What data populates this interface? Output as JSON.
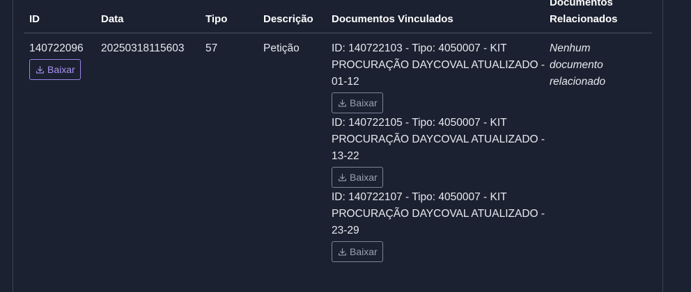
{
  "table": {
    "headers": {
      "id": "ID",
      "data": "Data",
      "tipo": "Tipo",
      "descricao": "Descrição",
      "vinculados": "Documentos Vinculados",
      "relacionados_line1": "Documentos",
      "relacionados_line2": "Relacionados"
    },
    "row": {
      "id": "140722096",
      "data": "20250318115603",
      "tipo": "57",
      "descricao": "Petição",
      "download_label": "Baixar",
      "relacionados": [
        "Nenhum",
        "documento",
        "relacionado"
      ],
      "vinculados": [
        {
          "lines": [
            "ID: 140722103 - Tipo: 4050007 - KIT",
            "PROCURAÇÃO DAYCOVAL ATUALIZADO -",
            "01-12"
          ],
          "download_label": "Baixar"
        },
        {
          "lines": [
            "ID: 140722105 - Tipo: 4050007 - KIT",
            "PROCURAÇÃO DAYCOVAL ATUALIZADO -",
            "13-22"
          ],
          "download_label": "Baixar"
        },
        {
          "lines": [
            "ID: 140722107 - Tipo: 4050007 - KIT",
            "PROCURAÇÃO DAYCOVAL ATUALIZADO -",
            "23-29"
          ],
          "download_label": "Baixar"
        }
      ]
    }
  },
  "colors": {
    "background": "#1b2130",
    "primary_button": "#a893f2",
    "secondary_button": "#9aa1ae"
  },
  "icons": {
    "download": "download-icon"
  }
}
